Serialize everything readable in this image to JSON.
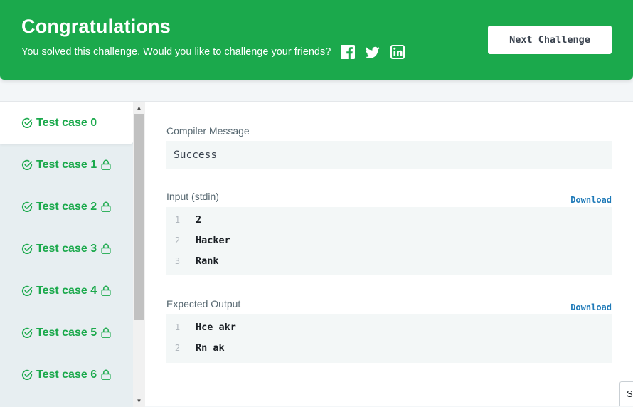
{
  "banner": {
    "title": "Congratulations",
    "subtitle": "You solved this challenge. Would you like to challenge your friends?",
    "next_label": "Next Challenge",
    "color": "#1ba94c",
    "share_icons": [
      "facebook-icon",
      "twitter-icon",
      "linkedin-icon"
    ]
  },
  "test_cases": [
    {
      "label": "Test case 0",
      "passed": true,
      "locked": false,
      "active": true
    },
    {
      "label": "Test case 1",
      "passed": true,
      "locked": true,
      "active": false
    },
    {
      "label": "Test case 2",
      "passed": true,
      "locked": true,
      "active": false
    },
    {
      "label": "Test case 3",
      "passed": true,
      "locked": true,
      "active": false
    },
    {
      "label": "Test case 4",
      "passed": true,
      "locked": true,
      "active": false
    },
    {
      "label": "Test case 5",
      "passed": true,
      "locked": true,
      "active": false
    },
    {
      "label": "Test case 6",
      "passed": true,
      "locked": true,
      "active": false
    }
  ],
  "compiler": {
    "label": "Compiler Message",
    "message": "Success"
  },
  "input": {
    "label": "Input (stdin)",
    "download_label": "Download",
    "lines": [
      {
        "num": "1",
        "text": "2"
      },
      {
        "num": "2",
        "text": "Hacker"
      },
      {
        "num": "3",
        "text": "Rank"
      }
    ]
  },
  "expected": {
    "label": "Expected Output",
    "download_label": "Download",
    "lines": [
      {
        "num": "1",
        "text": "Hce akr"
      },
      {
        "num": "2",
        "text": "Rn ak"
      }
    ]
  },
  "corner_widget": {
    "text": "S"
  },
  "colors": {
    "success_green": "#1ba94c",
    "link_blue": "#1f7ab8",
    "sidebar_bg": "#e7eef1"
  }
}
